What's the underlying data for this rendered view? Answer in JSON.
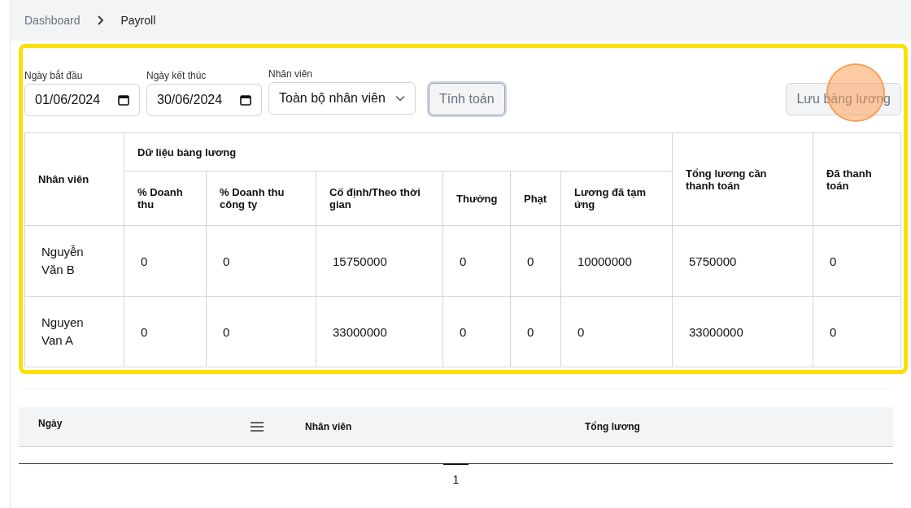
{
  "breadcrumb": [
    {
      "label": "Dashboard",
      "current": false
    },
    {
      "label": "Payroll",
      "current": true
    }
  ],
  "filters": {
    "start_date": {
      "label": "Ngày bắt đầu",
      "value": "01/06/2024"
    },
    "end_date": {
      "label": "Ngày kết thúc",
      "value": "30/06/2024"
    },
    "employee": {
      "label": "Nhân viên",
      "value": "Toàn bộ nhân viên"
    },
    "calculate_button": "Tính toán",
    "save_button": "Lưu bảng lương"
  },
  "payroll_table": {
    "employee_header": "Nhân viên",
    "group_header": "Dữ liệu bảng lương",
    "group_columns": [
      "% Doanh thu",
      "% Doanh thu công ty",
      "Cố định/Theo thời gian",
      "Thưởng",
      "Phạt",
      "Lương đã tạm ứng"
    ],
    "total_header": "Tổng lương cần thanh toán",
    "paid_header": "Đã thanh toán",
    "rows": [
      {
        "employee": "Nguyễn Văn B",
        "cells": [
          "0",
          "0",
          "15750000",
          "0",
          "0",
          "10000000"
        ],
        "total": "5750000",
        "paid": "0"
      },
      {
        "employee": "Nguyen Van A",
        "cells": [
          "0",
          "0",
          "33000000",
          "0",
          "0",
          "0"
        ],
        "total": "33000000",
        "paid": "0"
      }
    ]
  },
  "history_table": {
    "columns": [
      "Ngày",
      "Nhân viên",
      "Tổng lương"
    ]
  },
  "pagination": [
    {
      "label": "1",
      "selected": true
    }
  ]
}
